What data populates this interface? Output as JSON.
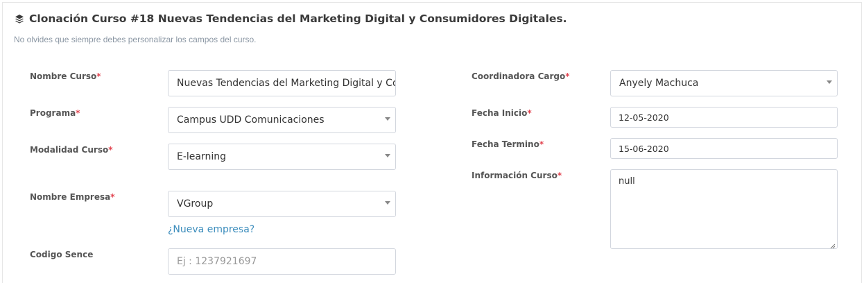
{
  "header": {
    "title": "Clonación Curso #18 Nuevas Tendencias del Marketing Digital y Consumidores Digitales.",
    "subtitle": "No olvides que siempre debes personalizar los campos del curso.",
    "icon": "layers-icon"
  },
  "required_marker": "*",
  "form": {
    "nombre_curso": {
      "label": "Nombre Curso",
      "value": "Nuevas Tendencias del Marketing Digital y Co"
    },
    "programa": {
      "label": "Programa",
      "value": "Campus UDD Comunicaciones"
    },
    "modalidad": {
      "label": "Modalidad Curso",
      "value": "E-learning"
    },
    "empresa": {
      "label": "Nombre Empresa",
      "value": "VGroup",
      "new_link": "¿Nueva empresa?"
    },
    "codigo_sence": {
      "label": "Codigo Sence",
      "placeholder": "Ej : 1237921697"
    },
    "coordinadora": {
      "label": "Coordinadora Cargo",
      "value": "Anyely Machuca"
    },
    "fecha_inicio": {
      "label": "Fecha Inicio",
      "value": "12-05-2020"
    },
    "fecha_termino": {
      "label": "Fecha Termino",
      "value": "15-06-2020"
    },
    "informacion": {
      "label": "Información Curso",
      "value": "null"
    }
  },
  "colors": {
    "required": "#e2434f",
    "link": "#3c8dbc",
    "border": "#d2d6de"
  }
}
